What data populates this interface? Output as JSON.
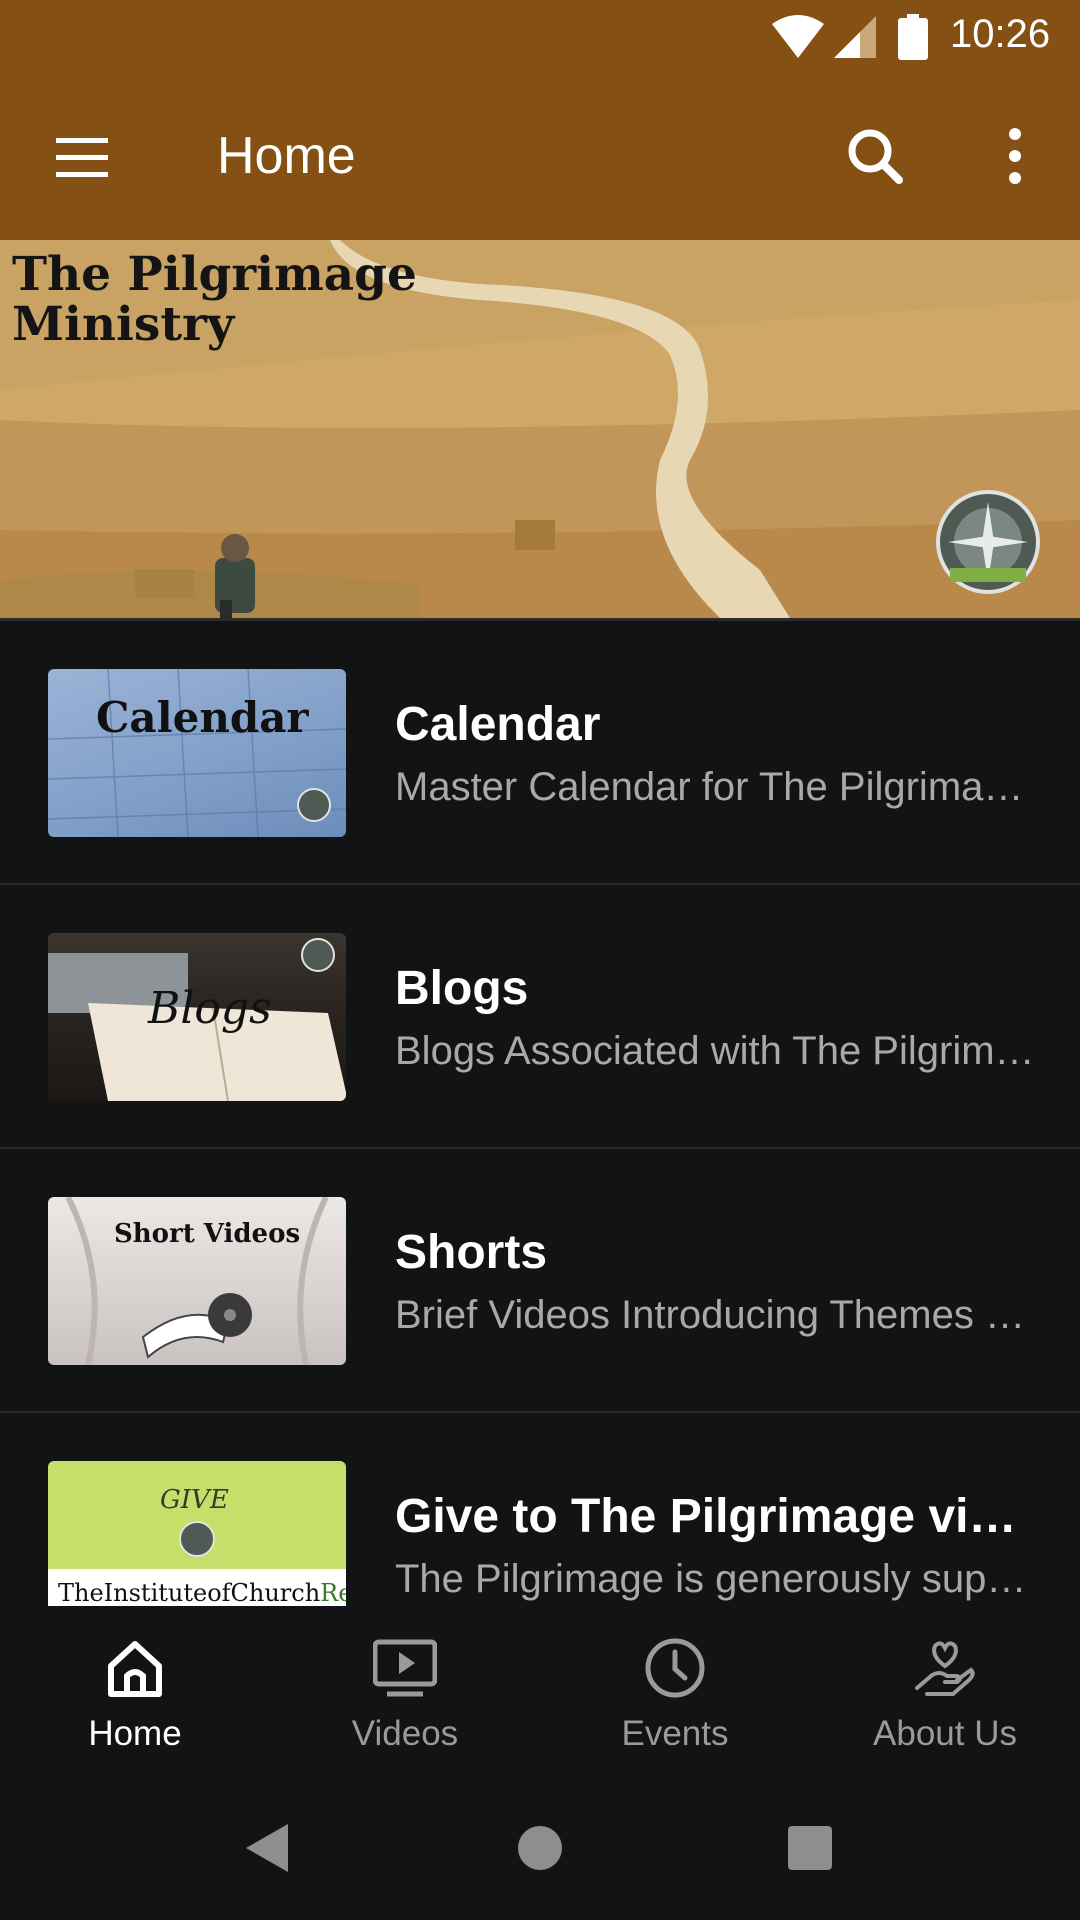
{
  "status_bar": {
    "time": "10:26",
    "icons": [
      "wifi-icon",
      "cell-signal-icon",
      "battery-icon"
    ]
  },
  "app_bar": {
    "title": "Home",
    "icons": [
      "menu-icon",
      "search-icon",
      "more-vert-icon"
    ],
    "background": "#845014"
  },
  "hero": {
    "title": "The Pilgrimage\nMinistry"
  },
  "thumbnails": {
    "calendar": "Calendar",
    "blogs": "Blogs",
    "shorts": "Short Videos",
    "give_top": "GIVE",
    "give_bottom_1": "TheInstituteofChurch",
    "give_bottom_2": "Renewal"
  },
  "list": {
    "items": [
      {
        "title": "Calendar",
        "subtitle": "Master Calendar for The Pilgrimage Ministry"
      },
      {
        "title": "Blogs",
        "subtitle": "Blogs Associated with The Pilgrimage"
      },
      {
        "title": "Shorts",
        "subtitle": "Brief Videos Introducing Themes of The Pilgrimage"
      },
      {
        "title": "Give to The Pilgrimage via The Institute of Church Renewal",
        "subtitle": "The Pilgrimage is generously supported"
      }
    ]
  },
  "bottom_nav": {
    "items": [
      {
        "label": "Home",
        "icon": "home-icon",
        "active": true
      },
      {
        "label": "Videos",
        "icon": "videos-icon",
        "active": false
      },
      {
        "label": "Events",
        "icon": "clock-icon",
        "active": false
      },
      {
        "label": "About Us",
        "icon": "heart-hand-icon",
        "active": false
      }
    ]
  },
  "system_nav": {
    "icons": [
      "back-icon",
      "home-circle-icon",
      "recents-icon"
    ]
  },
  "colors": {
    "accent": "#845014",
    "background": "#121315",
    "secondary_text": "#a9a9ab"
  }
}
